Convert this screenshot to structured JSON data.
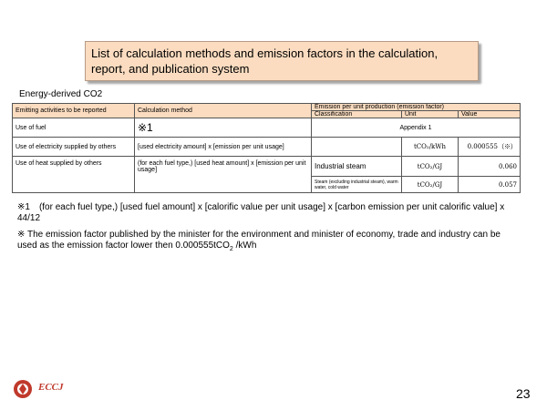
{
  "title": {
    "line1": "List of calculation methods and emission factors in the calculation,",
    "line2": "report, and publication system"
  },
  "section_label": "Energy-derived CO2",
  "table": {
    "headers": {
      "activities": "Emitting activities to be reported",
      "method": "Calculation method",
      "factor_group": "Emission per unit production (emission factor)",
      "classification": "Classification",
      "unit": "Unit",
      "value": "Value"
    },
    "rows": [
      {
        "activity": "Use of fuel",
        "method": "※1",
        "merged": "Appendix 1"
      },
      {
        "activity": "Use of electricity supplied by others",
        "method": "[used electricity amount] x [emission per unit usage]",
        "classification": "",
        "unit": "tCO₂/kWh",
        "value": "0.000555（※）"
      },
      {
        "activity": "Use of heat supplied by others",
        "method": "(for each fuel type,) [used heat amount] x [emission per unit usage]",
        "sub": [
          {
            "classification": "Industrial steam",
            "unit": "tCO₂/GJ",
            "value": "0.060"
          },
          {
            "classification": "Steam (excluding industrial steam), warm water, cold water",
            "unit": "tCO₂/GJ",
            "value": "0.057"
          }
        ]
      }
    ]
  },
  "notes": {
    "note1": "※1　(for each fuel type,) [used fuel amount] x [calorific value per unit usage] x [carbon emission per unit calorific value] x 44/12",
    "note2_prefix": "※ The emission factor published by the minister for the environment and minister of economy, trade and industry can be used as the emission factor lower then 0.000555tCO",
    "note2_sub": "2",
    "note2_suffix": " /kWh"
  },
  "logo_text": "ECCJ",
  "page_number": "23",
  "colors": {
    "header_bg": "#fbdcc0",
    "logo_red": "#c0392b"
  }
}
